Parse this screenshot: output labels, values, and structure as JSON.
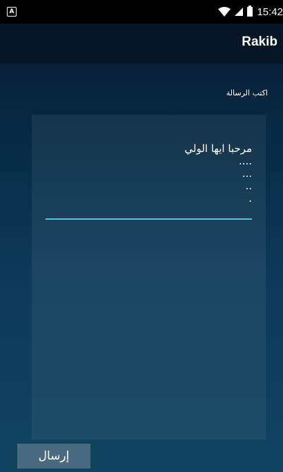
{
  "status_bar": {
    "left_icon": "A",
    "icons": [
      "wifi-icon",
      "signal-icon",
      "battery-icon"
    ],
    "time": "15:42"
  },
  "app_bar": {
    "title": "Rakib"
  },
  "compose": {
    "label": "اكتب الرسالة",
    "message_value": "مرحبا ايها الولي\n....\n...\n..\n."
  },
  "actions": {
    "send_label": "إرسال"
  },
  "colors": {
    "accent": "#4fc3e0",
    "button": "#4a6a80",
    "app_bar": "#061527"
  }
}
